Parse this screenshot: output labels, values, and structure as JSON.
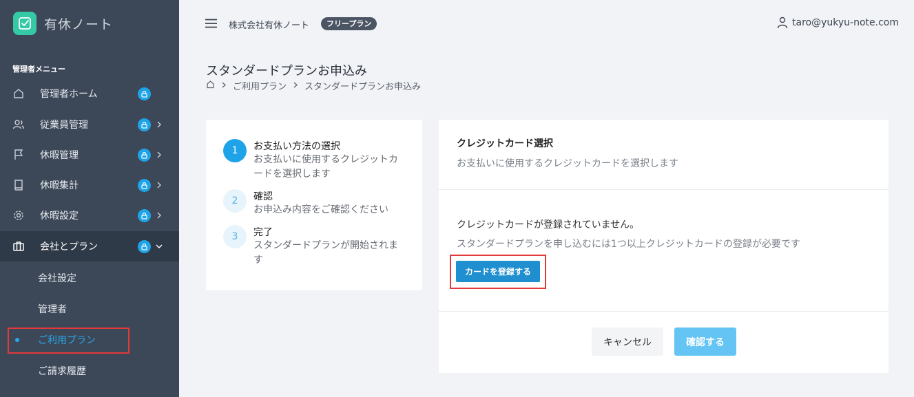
{
  "app": {
    "title": "有休ノート"
  },
  "sidebar": {
    "menu_header": "管理者メニュー",
    "items": [
      {
        "label": "管理者ホーム",
        "icon": "home-icon"
      },
      {
        "label": "従業員管理",
        "icon": "users-icon"
      },
      {
        "label": "休暇管理",
        "icon": "flag-icon"
      },
      {
        "label": "休暇集計",
        "icon": "book-icon"
      },
      {
        "label": "休暇設定",
        "icon": "gear-icon"
      },
      {
        "label": "会社とプラン",
        "icon": "briefcase-icon"
      }
    ],
    "sub_items": [
      {
        "label": "会社設定"
      },
      {
        "label": "管理者"
      },
      {
        "label": "ご利用プラン"
      },
      {
        "label": "ご請求履歴"
      }
    ]
  },
  "header": {
    "company": "株式会社有休ノート",
    "plan_badge": "フリープラン",
    "user_email": "taro@yukyu-note.com"
  },
  "page": {
    "title": "スタンダードプランお申込み",
    "breadcrumb": [
      "ご利用プラン",
      "スタンダードプランお申込み"
    ]
  },
  "steps": [
    {
      "num": "1",
      "title": "お支払い方法の選択",
      "desc": "お支払いに使用するクレジットカードを選択します"
    },
    {
      "num": "2",
      "title": "確認",
      "desc": "お申込み内容をご確認ください"
    },
    {
      "num": "3",
      "title": "完了",
      "desc": "スタンダードプランが開始されます"
    }
  ],
  "card": {
    "title": "クレジットカード選択",
    "subtitle": "お支払いに使用するクレジットカードを選択します",
    "no_card": "クレジットカードが登録されていません。",
    "no_card_desc": "スタンダードプランを申し込むには1つ以上クレジットカードの登録が必要です",
    "register_button": "カードを登録する",
    "cancel_button": "キャンセル",
    "confirm_button": "確認する"
  },
  "colors": {
    "sidebar_bg": "#3c4858",
    "accent": "#1ea3e8",
    "logo": "#35c9a6",
    "highlight": "#e23a3a"
  }
}
